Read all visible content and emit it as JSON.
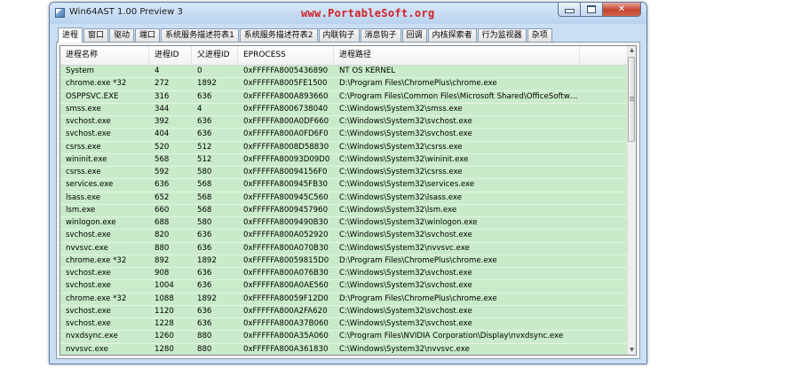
{
  "window": {
    "title": "Win64AST 1.00 Preview 3",
    "watermark": "www.PortableSoft.org",
    "controls": {
      "minimize": "",
      "maximize": "",
      "close": "✕"
    }
  },
  "tabs": [
    {
      "label": "进程",
      "active": true
    },
    {
      "label": "窗口"
    },
    {
      "label": "驱动"
    },
    {
      "label": "端口"
    },
    {
      "label": "系统服务描述符表1"
    },
    {
      "label": "系统服务描述符表2"
    },
    {
      "label": "内联钩子"
    },
    {
      "label": "消息钩子"
    },
    {
      "label": "回调"
    },
    {
      "label": "内核探索者"
    },
    {
      "label": "行为监视器"
    },
    {
      "label": "杂项"
    }
  ],
  "table": {
    "columns": [
      "进程名称",
      "进程ID",
      "父进程ID",
      "EPROCESS",
      "进程路径",
      ""
    ],
    "rows": [
      [
        "System",
        "4",
        "0",
        "0xFFFFFA8005436890",
        "NT OS KERNEL"
      ],
      [
        "chrome.exe *32",
        "272",
        "1892",
        "0xFFFFFA8005FE1500",
        "D:\\Program Files\\ChromePlus\\chrome.exe"
      ],
      [
        "OSPPSVC.EXE",
        "316",
        "636",
        "0xFFFFFA800A893660",
        "C:\\Program Files\\Common Files\\Microsoft Shared\\OfficeSoftwar..."
      ],
      [
        "smss.exe",
        "344",
        "4",
        "0xFFFFFA8006738040",
        "C:\\Windows\\System32\\smss.exe"
      ],
      [
        "svchost.exe",
        "392",
        "636",
        "0xFFFFFA800A0DF660",
        "C:\\Windows\\System32\\svchost.exe"
      ],
      [
        "svchost.exe",
        "404",
        "636",
        "0xFFFFFA800A0FD6F0",
        "C:\\Windows\\System32\\svchost.exe"
      ],
      [
        "csrss.exe",
        "520",
        "512",
        "0xFFFFFA8008D58830",
        "C:\\Windows\\System32\\csrss.exe"
      ],
      [
        "wininit.exe",
        "568",
        "512",
        "0xFFFFFA80093D09D0",
        "C:\\Windows\\System32\\wininit.exe"
      ],
      [
        "csrss.exe",
        "592",
        "580",
        "0xFFFFFA80094156F0",
        "C:\\Windows\\System32\\csrss.exe"
      ],
      [
        "services.exe",
        "636",
        "568",
        "0xFFFFFA800945FB30",
        "C:\\Windows\\System32\\services.exe"
      ],
      [
        "lsass.exe",
        "652",
        "568",
        "0xFFFFFA800945C560",
        "C:\\Windows\\System32\\lsass.exe"
      ],
      [
        "lsm.exe",
        "660",
        "568",
        "0xFFFFFA8009457960",
        "C:\\Windows\\System32\\lsm.exe"
      ],
      [
        "winlogon.exe",
        "688",
        "580",
        "0xFFFFFA8009490B30",
        "C:\\Windows\\System32\\winlogon.exe"
      ],
      [
        "svchost.exe",
        "820",
        "636",
        "0xFFFFFA800A052920",
        "C:\\Windows\\System32\\svchost.exe"
      ],
      [
        "nvvsvc.exe",
        "880",
        "636",
        "0xFFFFFA800A070B30",
        "C:\\Windows\\System32\\nvvsvc.exe"
      ],
      [
        "chrome.exe *32",
        "892",
        "1892",
        "0xFFFFFA80059815D0",
        "D:\\Program Files\\ChromePlus\\chrome.exe"
      ],
      [
        "svchost.exe",
        "908",
        "636",
        "0xFFFFFA800A076B30",
        "C:\\Windows\\System32\\svchost.exe"
      ],
      [
        "svchost.exe",
        "1004",
        "636",
        "0xFFFFFA800A0AE560",
        "C:\\Windows\\System32\\svchost.exe"
      ],
      [
        "chrome.exe *32",
        "1088",
        "1892",
        "0xFFFFFA80059F12D0",
        "D:\\Program Files\\ChromePlus\\chrome.exe"
      ],
      [
        "svchost.exe",
        "1120",
        "636",
        "0xFFFFFA800A2FA620",
        "C:\\Windows\\System32\\svchost.exe"
      ],
      [
        "svchost.exe",
        "1228",
        "636",
        "0xFFFFFA800A37B060",
        "C:\\Windows\\System32\\svchost.exe"
      ],
      [
        "nvxdsync.exe",
        "1260",
        "880",
        "0xFFFFFA800A35A060",
        "C:\\Program Files\\NVIDIA Corporation\\Display\\nvxdsync.exe"
      ],
      [
        "nvvsvc.exe",
        "1280",
        "880",
        "0xFFFFFA800A361830",
        "C:\\Windows\\System32\\nvvsvc.exe"
      ],
      [
        "...",
        "",
        "",
        "",
        ""
      ]
    ]
  },
  "colors": {
    "row_background": "#c9ebc9",
    "watermark": "#d21f24",
    "titlebar": "#c9dff5"
  },
  "icons": {
    "app": "app-window-icon",
    "scroll_up": "chevron-up-icon",
    "scroll_down": "chevron-down-icon"
  }
}
